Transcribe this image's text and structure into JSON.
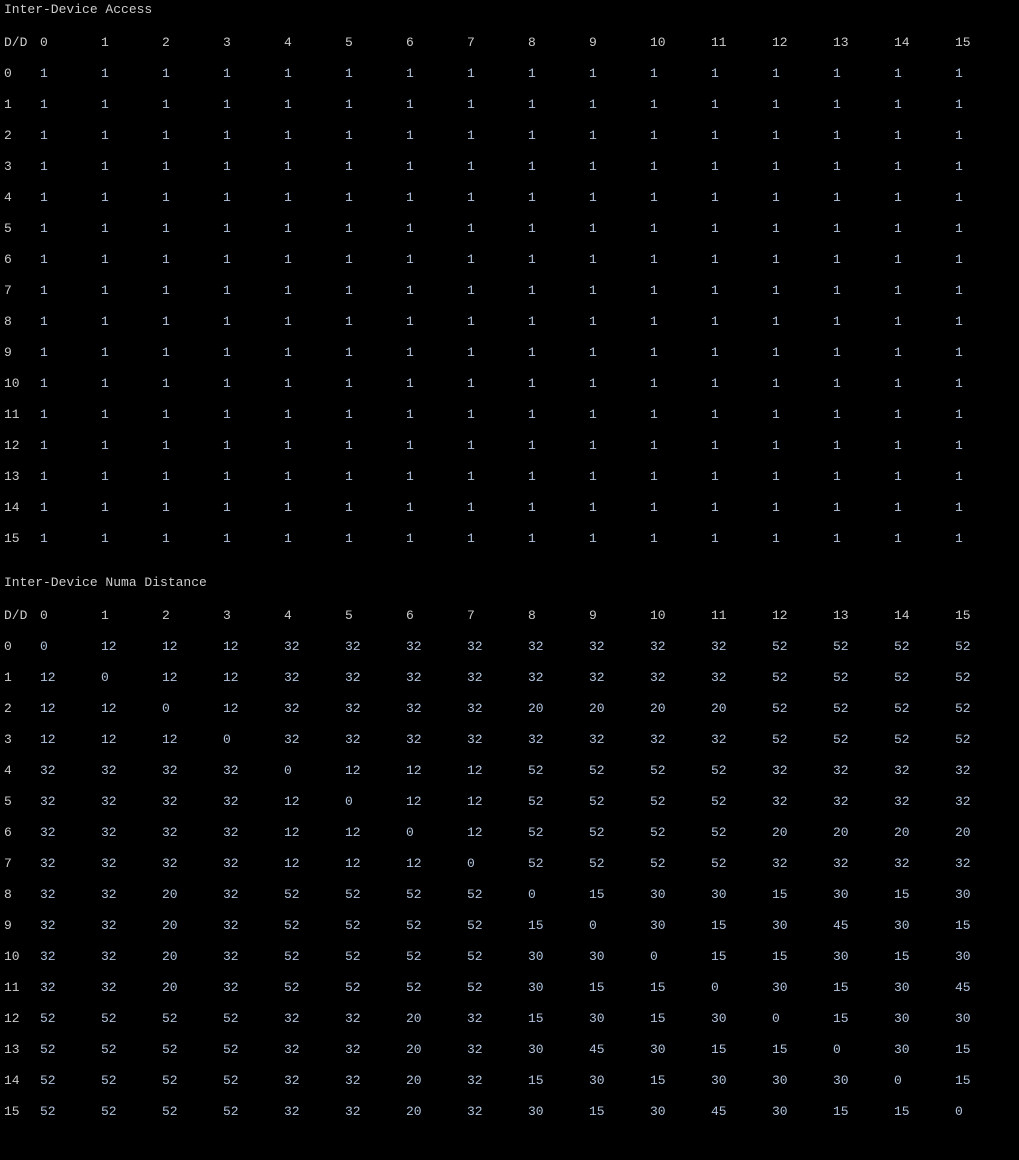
{
  "sections": [
    {
      "title": "Inter-Device Access",
      "corner": "D/D",
      "col_headers": [
        "0",
        "1",
        "2",
        "3",
        "4",
        "5",
        "6",
        "7",
        "8",
        "9",
        "10",
        "11",
        "12",
        "13",
        "14",
        "15"
      ],
      "rows": [
        {
          "hdr": "0",
          "cells": [
            "1",
            "1",
            "1",
            "1",
            "1",
            "1",
            "1",
            "1",
            "1",
            "1",
            "1",
            "1",
            "1",
            "1",
            "1",
            "1"
          ]
        },
        {
          "hdr": "1",
          "cells": [
            "1",
            "1",
            "1",
            "1",
            "1",
            "1",
            "1",
            "1",
            "1",
            "1",
            "1",
            "1",
            "1",
            "1",
            "1",
            "1"
          ]
        },
        {
          "hdr": "2",
          "cells": [
            "1",
            "1",
            "1",
            "1",
            "1",
            "1",
            "1",
            "1",
            "1",
            "1",
            "1",
            "1",
            "1",
            "1",
            "1",
            "1"
          ]
        },
        {
          "hdr": "3",
          "cells": [
            "1",
            "1",
            "1",
            "1",
            "1",
            "1",
            "1",
            "1",
            "1",
            "1",
            "1",
            "1",
            "1",
            "1",
            "1",
            "1"
          ]
        },
        {
          "hdr": "4",
          "cells": [
            "1",
            "1",
            "1",
            "1",
            "1",
            "1",
            "1",
            "1",
            "1",
            "1",
            "1",
            "1",
            "1",
            "1",
            "1",
            "1"
          ]
        },
        {
          "hdr": "5",
          "cells": [
            "1",
            "1",
            "1",
            "1",
            "1",
            "1",
            "1",
            "1",
            "1",
            "1",
            "1",
            "1",
            "1",
            "1",
            "1",
            "1"
          ]
        },
        {
          "hdr": "6",
          "cells": [
            "1",
            "1",
            "1",
            "1",
            "1",
            "1",
            "1",
            "1",
            "1",
            "1",
            "1",
            "1",
            "1",
            "1",
            "1",
            "1"
          ]
        },
        {
          "hdr": "7",
          "cells": [
            "1",
            "1",
            "1",
            "1",
            "1",
            "1",
            "1",
            "1",
            "1",
            "1",
            "1",
            "1",
            "1",
            "1",
            "1",
            "1"
          ]
        },
        {
          "hdr": "8",
          "cells": [
            "1",
            "1",
            "1",
            "1",
            "1",
            "1",
            "1",
            "1",
            "1",
            "1",
            "1",
            "1",
            "1",
            "1",
            "1",
            "1"
          ]
        },
        {
          "hdr": "9",
          "cells": [
            "1",
            "1",
            "1",
            "1",
            "1",
            "1",
            "1",
            "1",
            "1",
            "1",
            "1",
            "1",
            "1",
            "1",
            "1",
            "1"
          ]
        },
        {
          "hdr": "10",
          "cells": [
            "1",
            "1",
            "1",
            "1",
            "1",
            "1",
            "1",
            "1",
            "1",
            "1",
            "1",
            "1",
            "1",
            "1",
            "1",
            "1"
          ]
        },
        {
          "hdr": "11",
          "cells": [
            "1",
            "1",
            "1",
            "1",
            "1",
            "1",
            "1",
            "1",
            "1",
            "1",
            "1",
            "1",
            "1",
            "1",
            "1",
            "1"
          ]
        },
        {
          "hdr": "12",
          "cells": [
            "1",
            "1",
            "1",
            "1",
            "1",
            "1",
            "1",
            "1",
            "1",
            "1",
            "1",
            "1",
            "1",
            "1",
            "1",
            "1"
          ]
        },
        {
          "hdr": "13",
          "cells": [
            "1",
            "1",
            "1",
            "1",
            "1",
            "1",
            "1",
            "1",
            "1",
            "1",
            "1",
            "1",
            "1",
            "1",
            "1",
            "1"
          ]
        },
        {
          "hdr": "14",
          "cells": [
            "1",
            "1",
            "1",
            "1",
            "1",
            "1",
            "1",
            "1",
            "1",
            "1",
            "1",
            "1",
            "1",
            "1",
            "1",
            "1"
          ]
        },
        {
          "hdr": "15",
          "cells": [
            "1",
            "1",
            "1",
            "1",
            "1",
            "1",
            "1",
            "1",
            "1",
            "1",
            "1",
            "1",
            "1",
            "1",
            "1",
            "1"
          ]
        }
      ]
    },
    {
      "title": "Inter-Device Numa Distance",
      "corner": "D/D",
      "col_headers": [
        "0",
        "1",
        "2",
        "3",
        "4",
        "5",
        "6",
        "7",
        "8",
        "9",
        "10",
        "11",
        "12",
        "13",
        "14",
        "15"
      ],
      "rows": [
        {
          "hdr": "0",
          "cells": [
            "0",
            "12",
            "12",
            "12",
            "32",
            "32",
            "32",
            "32",
            "32",
            "32",
            "32",
            "32",
            "52",
            "52",
            "52",
            "52"
          ]
        },
        {
          "hdr": "1",
          "cells": [
            "12",
            "0",
            "12",
            "12",
            "32",
            "32",
            "32",
            "32",
            "32",
            "32",
            "32",
            "32",
            "52",
            "52",
            "52",
            "52"
          ]
        },
        {
          "hdr": "2",
          "cells": [
            "12",
            "12",
            "0",
            "12",
            "32",
            "32",
            "32",
            "32",
            "20",
            "20",
            "20",
            "20",
            "52",
            "52",
            "52",
            "52"
          ]
        },
        {
          "hdr": "3",
          "cells": [
            "12",
            "12",
            "12",
            "0",
            "32",
            "32",
            "32",
            "32",
            "32",
            "32",
            "32",
            "32",
            "52",
            "52",
            "52",
            "52"
          ]
        },
        {
          "hdr": "4",
          "cells": [
            "32",
            "32",
            "32",
            "32",
            "0",
            "12",
            "12",
            "12",
            "52",
            "52",
            "52",
            "52",
            "32",
            "32",
            "32",
            "32"
          ]
        },
        {
          "hdr": "5",
          "cells": [
            "32",
            "32",
            "32",
            "32",
            "12",
            "0",
            "12",
            "12",
            "52",
            "52",
            "52",
            "52",
            "32",
            "32",
            "32",
            "32"
          ]
        },
        {
          "hdr": "6",
          "cells": [
            "32",
            "32",
            "32",
            "32",
            "12",
            "12",
            "0",
            "12",
            "52",
            "52",
            "52",
            "52",
            "20",
            "20",
            "20",
            "20"
          ]
        },
        {
          "hdr": "7",
          "cells": [
            "32",
            "32",
            "32",
            "32",
            "12",
            "12",
            "12",
            "0",
            "52",
            "52",
            "52",
            "52",
            "32",
            "32",
            "32",
            "32"
          ]
        },
        {
          "hdr": "8",
          "cells": [
            "32",
            "32",
            "20",
            "32",
            "52",
            "52",
            "52",
            "52",
            "0",
            "15",
            "30",
            "30",
            "15",
            "30",
            "15",
            "30"
          ]
        },
        {
          "hdr": "9",
          "cells": [
            "32",
            "32",
            "20",
            "32",
            "52",
            "52",
            "52",
            "52",
            "15",
            "0",
            "30",
            "15",
            "30",
            "45",
            "30",
            "15"
          ]
        },
        {
          "hdr": "10",
          "cells": [
            "32",
            "32",
            "20",
            "32",
            "52",
            "52",
            "52",
            "52",
            "30",
            "30",
            "0",
            "15",
            "15",
            "30",
            "15",
            "30"
          ]
        },
        {
          "hdr": "11",
          "cells": [
            "32",
            "32",
            "20",
            "32",
            "52",
            "52",
            "52",
            "52",
            "30",
            "15",
            "15",
            "0",
            "30",
            "15",
            "30",
            "45"
          ]
        },
        {
          "hdr": "12",
          "cells": [
            "52",
            "52",
            "52",
            "52",
            "32",
            "32",
            "20",
            "32",
            "15",
            "30",
            "15",
            "30",
            "0",
            "15",
            "30",
            "30"
          ]
        },
        {
          "hdr": "13",
          "cells": [
            "52",
            "52",
            "52",
            "52",
            "32",
            "32",
            "20",
            "32",
            "30",
            "45",
            "30",
            "15",
            "15",
            "0",
            "30",
            "15"
          ]
        },
        {
          "hdr": "14",
          "cells": [
            "52",
            "52",
            "52",
            "52",
            "32",
            "32",
            "20",
            "32",
            "15",
            "30",
            "15",
            "30",
            "30",
            "30",
            "0",
            "15"
          ]
        },
        {
          "hdr": "15",
          "cells": [
            "52",
            "52",
            "52",
            "52",
            "32",
            "32",
            "20",
            "32",
            "30",
            "15",
            "30",
            "45",
            "30",
            "15",
            "15",
            "0"
          ]
        }
      ]
    }
  ]
}
